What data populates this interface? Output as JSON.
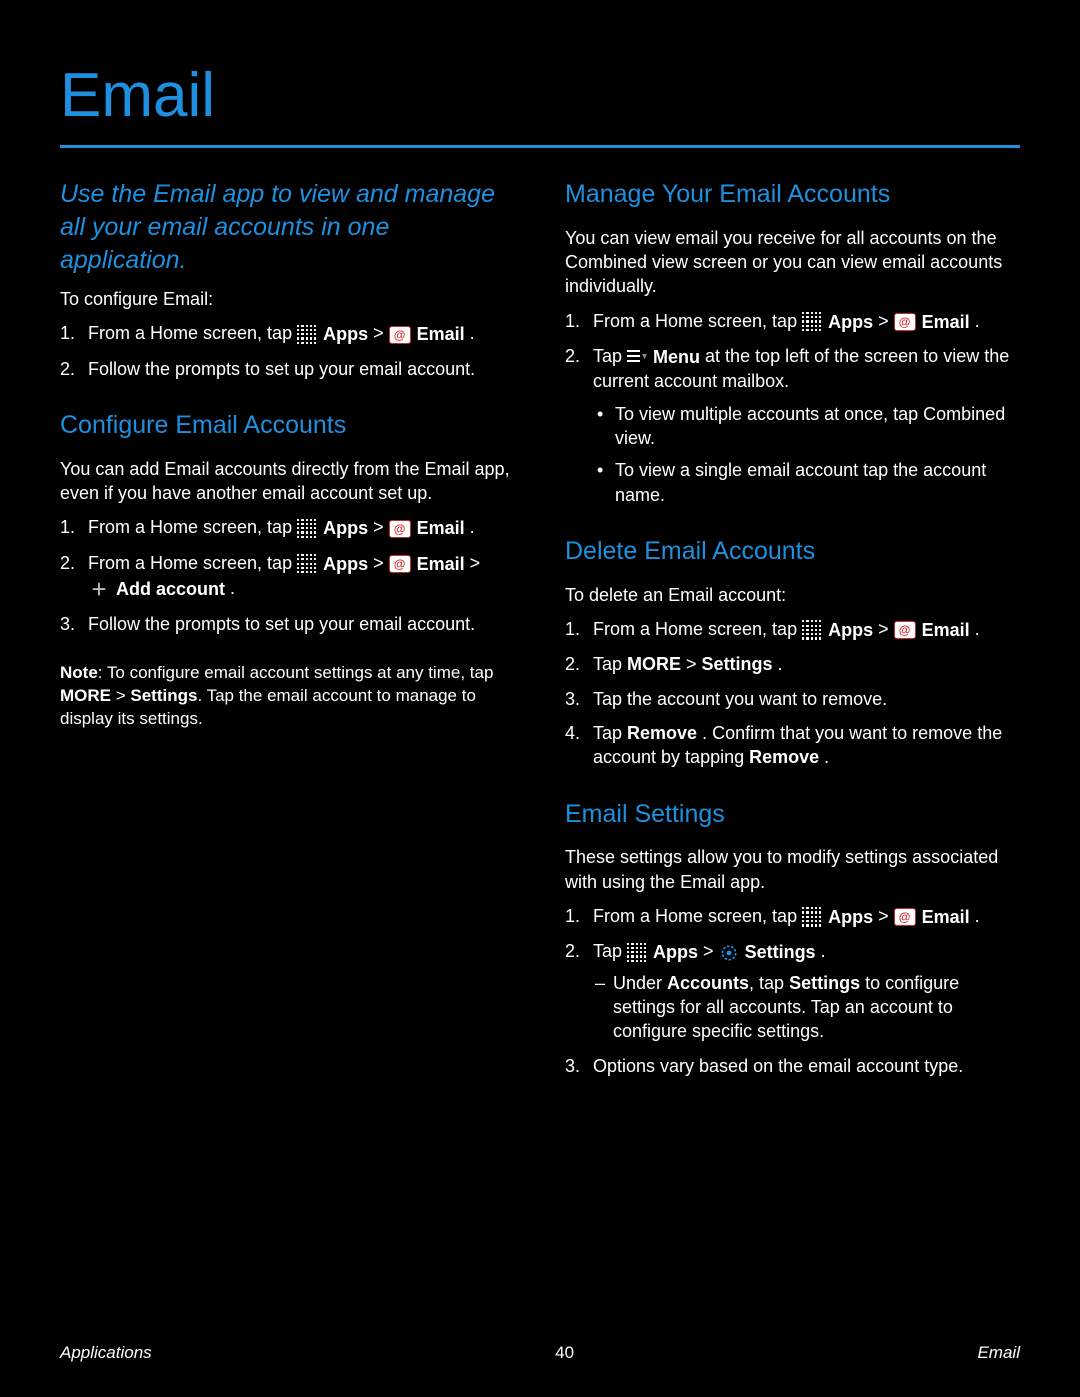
{
  "title": "Email",
  "intro": "Use the Email app to view and manage all your email accounts in one application.",
  "labels": {
    "apps": "Apps",
    "email": "Email",
    "menu": "Menu",
    "add_account": "Add account",
    "settings": "Settings",
    "more": "MORE",
    "settings_cap": "Settings",
    "accounts": "Accounts",
    "remove": "Remove"
  },
  "left": {
    "to_configure": "To configure Email:",
    "step_configure_1a": "From a Home screen, tap ",
    "step_configure_1b": ".",
    "step_configure_2": "Follow the prompts to set up your email account.",
    "h2": "Configure Email Accounts",
    "p1": "You can add Email accounts directly from the Email app, even if you have another email account set up.",
    "step_add_1a": "From a Home screen, tap ",
    "step_add_1b": ".",
    "step_more_1a": "From a Home screen, tap ",
    "step_more_1b": ".",
    "step_add_account_a": "",
    "step_add_account_b": "",
    "step_follow": "Follow the prompts to set up your email account.",
    "note_pre": "Note",
    "note_body_a": ": To configure email account settings at any time, tap ",
    "note_body_b": ". Tap the email account to manage to display its settings."
  },
  "right": {
    "h2a": "Manage Your Email Accounts",
    "p1": "You can view email you receive for all accounts on the Combined view screen or you can view email accounts individually.",
    "step_r1a": "From a Home screen, tap ",
    "step_r1b": ".",
    "step_r2a": "Tap ",
    "step_r2b": " at the top left of the screen to view the current account mailbox.",
    "step_r3": "To view multiple accounts at once, tap Combined view.",
    "step_r4": "To view a single email account tap the account name.",
    "h2b": "Delete Email Accounts",
    "p2": "To delete an Email account:",
    "del_1a": "From a Home screen, tap ",
    "del_1b": ".",
    "del_2a": "Tap ",
    "del_2b": ".",
    "del_3a": "Tap the account you want to remove.",
    "del_4a": "Tap ",
    "del_4b": ". Confirm that you want to remove the account by tapping ",
    "del_4c": ".",
    "h2c": "Email Settings",
    "p3": "These settings allow you to modify settings associated with using the Email app.",
    "es_1a": "From a Home screen, tap ",
    "es_1b": ".",
    "es_2a": "Tap ",
    "es_2b": ".",
    "es_sub1a": "Under ",
    "es_sub1b": ", tap ",
    "es_sub1c": " to configure settings for all accounts. Tap an account to configure specific settings.",
    "es_3": "Options vary based on the email account type."
  },
  "footer": {
    "left": "Applications",
    "center": "40",
    "right": "Email"
  }
}
